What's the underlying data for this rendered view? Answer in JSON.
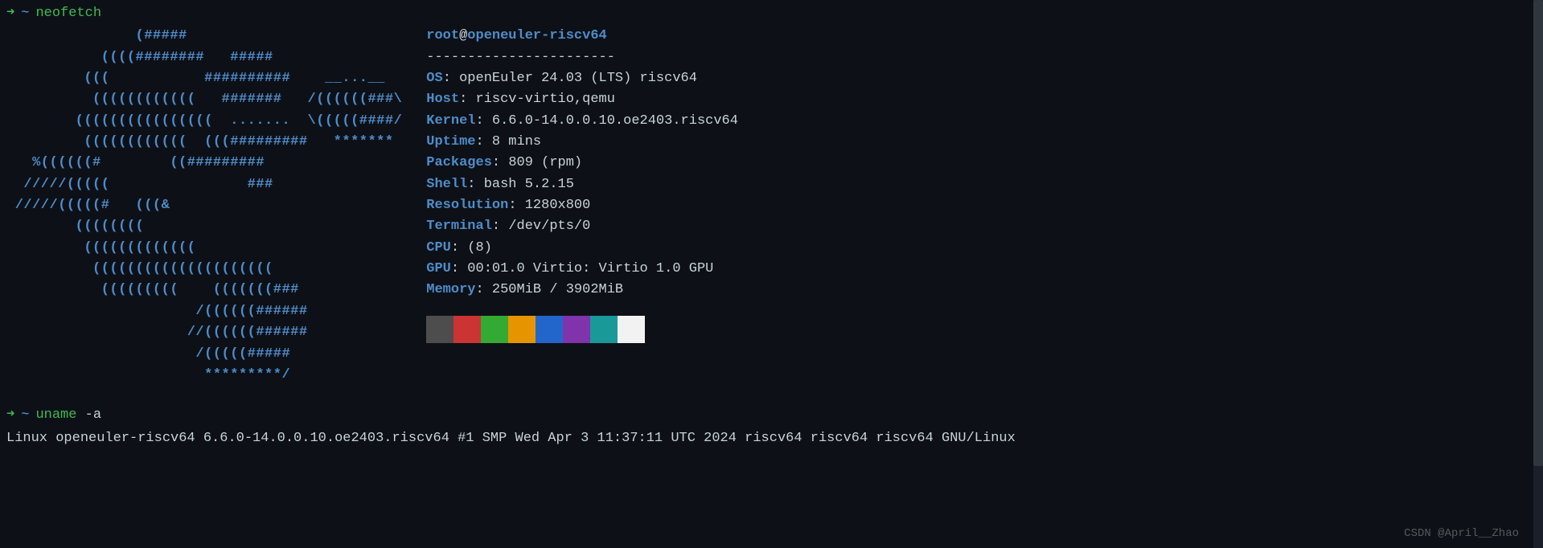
{
  "prompt1": {
    "arrow": "➜",
    "tilde": "~",
    "cmd": "neofetch"
  },
  "ascii": "               (#####\n           ((((########   #####\n         (((           ##########    __...__\n          ((((((((((((   #######   /((((((###\\\n        ((((((((((((((((  .......  \\(((((####/\n         ((((((((((((  (((#########   *******\n   %((((((#        ((#########\n  /////(((((                ###\n /////(((((#   (((&\n        ((((((((\n         (((((((((((((\n          (((((((((((((((((((((\n           (((((((((    (((((((###\n                      /((((((######\n                     //((((((######\n                      /(((((#####\n                       *********/",
  "userhost": {
    "user": "root",
    "at": "@",
    "host": "openeuler-riscv64"
  },
  "separator": "-----------------------",
  "info": {
    "os": {
      "label": "OS",
      "value": "openEuler 24.03 (LTS) riscv64"
    },
    "host": {
      "label": "Host",
      "value": "riscv-virtio,qemu"
    },
    "kernel": {
      "label": "Kernel",
      "value": "6.6.0-14.0.0.10.oe2403.riscv64"
    },
    "uptime": {
      "label": "Uptime",
      "value": "8 mins"
    },
    "packages": {
      "label": "Packages",
      "value": "809 (rpm)"
    },
    "shell": {
      "label": "Shell",
      "value": "bash 5.2.15"
    },
    "resolution": {
      "label": "Resolution",
      "value": "1280x800"
    },
    "terminal": {
      "label": "Terminal",
      "value": "/dev/pts/0"
    },
    "cpu": {
      "label": "CPU",
      "value": "(8)"
    },
    "gpu": {
      "label": "GPU",
      "value": "00:01.0 Virtio: Virtio 1.0 GPU"
    },
    "memory": {
      "label": "Memory",
      "value": "250MiB / 3902MiB"
    }
  },
  "colors": [
    "#4d4d4d",
    "#cc3333",
    "#33aa33",
    "#e69500",
    "#2266cc",
    "#8033aa",
    "#1a9999",
    "#f2f2f2"
  ],
  "prompt2": {
    "arrow": "➜",
    "tilde": "~",
    "cmd": "uname",
    "arg": "-a"
  },
  "uname_output": "Linux openeuler-riscv64 6.6.0-14.0.0.10.oe2403.riscv64 #1 SMP Wed Apr  3 11:37:11 UTC 2024 riscv64 riscv64 riscv64 GNU/Linux",
  "watermark": "CSDN @April__Zhao"
}
